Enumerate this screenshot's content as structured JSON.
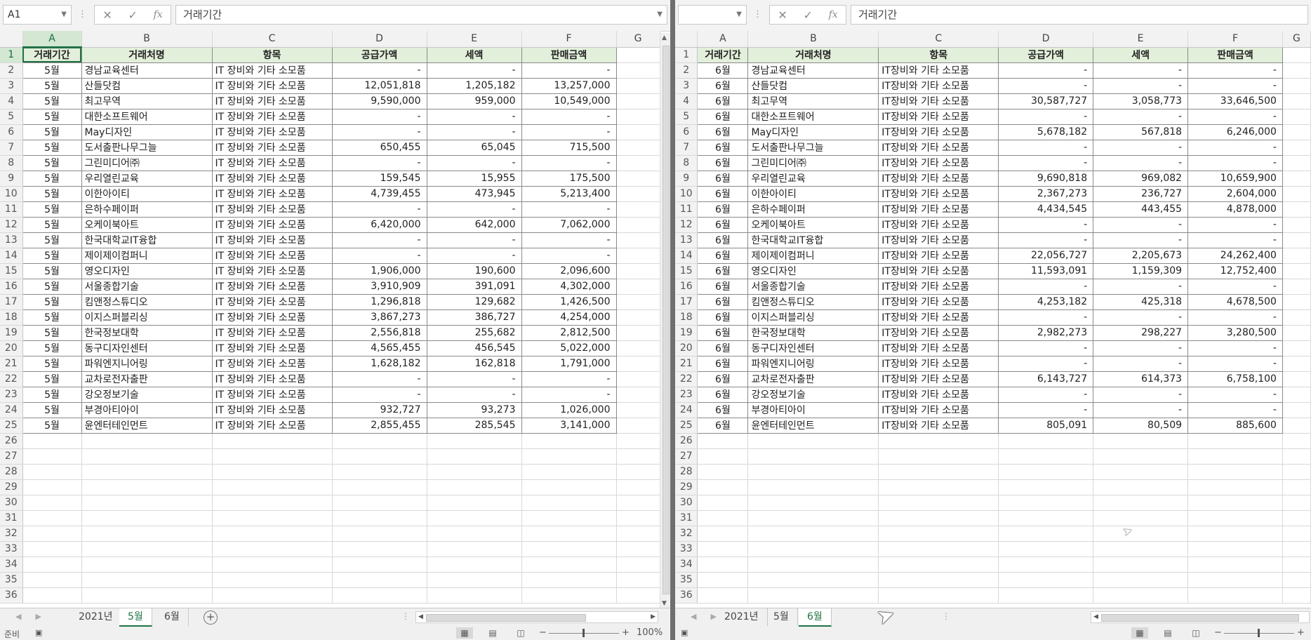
{
  "left": {
    "namebox": "A1",
    "formula": "거래기간",
    "columns": [
      "A",
      "B",
      "C",
      "D",
      "E",
      "F",
      "G"
    ],
    "header": [
      "거래기간",
      "거래처명",
      "항목",
      "공급가액",
      "세액",
      "판매금액"
    ],
    "rows": [
      [
        "5월",
        "경남교육센터",
        "IT 장비와 기타 소모품",
        "-",
        "-",
        "-"
      ],
      [
        "5월",
        "산들닷컴",
        "IT 장비와 기타 소모품",
        "12,051,818",
        "1,205,182",
        "13,257,000"
      ],
      [
        "5월",
        "최고무역",
        "IT 장비와 기타 소모품",
        "9,590,000",
        "959,000",
        "10,549,000"
      ],
      [
        "5월",
        "대한소프트웨어",
        "IT 장비와 기타 소모품",
        "-",
        "-",
        "-"
      ],
      [
        "5월",
        "May디자인",
        "IT 장비와 기타 소모품",
        "-",
        "-",
        "-"
      ],
      [
        "5월",
        "도서출판나무그늘",
        "IT 장비와 기타 소모품",
        "650,455",
        "65,045",
        "715,500"
      ],
      [
        "5월",
        "그린미디어㈜",
        "IT 장비와 기타 소모품",
        "-",
        "-",
        "-"
      ],
      [
        "5월",
        "우리열린교육",
        "IT 장비와 기타 소모품",
        "159,545",
        "15,955",
        "175,500"
      ],
      [
        "5월",
        "이한아이티",
        "IT 장비와 기타 소모품",
        "4,739,455",
        "473,945",
        "5,213,400"
      ],
      [
        "5월",
        "은하수페이퍼",
        "IT 장비와 기타 소모품",
        "-",
        "-",
        "-"
      ],
      [
        "5월",
        "오케이북아트",
        "IT 장비와 기타 소모품",
        "6,420,000",
        "642,000",
        "7,062,000"
      ],
      [
        "5월",
        "한국대학교IT융합",
        "IT 장비와 기타 소모품",
        "-",
        "-",
        "-"
      ],
      [
        "5월",
        "제이제이컴퍼니",
        "IT 장비와 기타 소모품",
        "-",
        "-",
        "-"
      ],
      [
        "5월",
        "영오디자인",
        "IT 장비와 기타 소모품",
        "1,906,000",
        "190,600",
        "2,096,600"
      ],
      [
        "5월",
        "서울종합기술",
        "IT 장비와 기타 소모품",
        "3,910,909",
        "391,091",
        "4,302,000"
      ],
      [
        "5월",
        "킴앤정스튜디오",
        "IT 장비와 기타 소모품",
        "1,296,818",
        "129,682",
        "1,426,500"
      ],
      [
        "5월",
        "이지스퍼블리싱",
        "IT 장비와 기타 소모품",
        "3,867,273",
        "386,727",
        "4,254,000"
      ],
      [
        "5월",
        "한국정보대학",
        "IT 장비와 기타 소모품",
        "2,556,818",
        "255,682",
        "2,812,500"
      ],
      [
        "5월",
        "동구디자인센터",
        "IT 장비와 기타 소모품",
        "4,565,455",
        "456,545",
        "5,022,000"
      ],
      [
        "5월",
        "파워엔지니어링",
        "IT 장비와 기타 소모품",
        "1,628,182",
        "162,818",
        "1,791,000"
      ],
      [
        "5월",
        "교차로전자출판",
        "IT 장비와 기타 소모품",
        "-",
        "-",
        "-"
      ],
      [
        "5월",
        "강오정보기술",
        "IT 장비와 기타 소모품",
        "-",
        "-",
        "-"
      ],
      [
        "5월",
        "부경아티아이",
        "IT 장비와 기타 소모품",
        "932,727",
        "93,273",
        "1,026,000"
      ],
      [
        "5월",
        "윤엔터테인먼트",
        "IT 장비와 기타 소모품",
        "2,855,455",
        "285,545",
        "3,141,000"
      ]
    ],
    "tabs": [
      "2021년",
      "5월",
      "6월"
    ],
    "active_tab": "5월"
  },
  "right": {
    "namebox": "",
    "formula": "거래기간",
    "columns": [
      "A",
      "B",
      "C",
      "D",
      "E",
      "F",
      "G"
    ],
    "header": [
      "거래기간",
      "거래처명",
      "항목",
      "공급가액",
      "세액",
      "판매금액"
    ],
    "rows": [
      [
        "6월",
        "경남교육센터",
        "IT장비와 기타 소모품",
        "-",
        "-",
        "-"
      ],
      [
        "6월",
        "산들닷컴",
        "IT장비와 기타 소모품",
        "-",
        "-",
        "-"
      ],
      [
        "6월",
        "최고무역",
        "IT장비와 기타 소모품",
        "30,587,727",
        "3,058,773",
        "33,646,500"
      ],
      [
        "6월",
        "대한소프트웨어",
        "IT장비와 기타 소모품",
        "-",
        "-",
        "-"
      ],
      [
        "6월",
        "May디자인",
        "IT장비와 기타 소모품",
        "5,678,182",
        "567,818",
        "6,246,000"
      ],
      [
        "6월",
        "도서출판나무그늘",
        "IT장비와 기타 소모품",
        "-",
        "-",
        "-"
      ],
      [
        "6월",
        "그린미디어㈜",
        "IT장비와 기타 소모품",
        "-",
        "-",
        "-"
      ],
      [
        "6월",
        "우리열린교육",
        "IT장비와 기타 소모품",
        "9,690,818",
        "969,082",
        "10,659,900"
      ],
      [
        "6월",
        "이한아이티",
        "IT장비와 기타 소모품",
        "2,367,273",
        "236,727",
        "2,604,000"
      ],
      [
        "6월",
        "은하수페이퍼",
        "IT장비와 기타 소모품",
        "4,434,545",
        "443,455",
        "4,878,000"
      ],
      [
        "6월",
        "오케이북아트",
        "IT장비와 기타 소모품",
        "-",
        "-",
        "-"
      ],
      [
        "6월",
        "한국대학교IT융합",
        "IT장비와 기타 소모품",
        "-",
        "-",
        "-"
      ],
      [
        "6월",
        "제이제이컴퍼니",
        "IT장비와 기타 소모품",
        "22,056,727",
        "2,205,673",
        "24,262,400"
      ],
      [
        "6월",
        "영오디자인",
        "IT장비와 기타 소모품",
        "11,593,091",
        "1,159,309",
        "12,752,400"
      ],
      [
        "6월",
        "서울종합기술",
        "IT장비와 기타 소모품",
        "-",
        "-",
        "-"
      ],
      [
        "6월",
        "킴앤정스튜디오",
        "IT장비와 기타 소모품",
        "4,253,182",
        "425,318",
        "4,678,500"
      ],
      [
        "6월",
        "이지스퍼블리싱",
        "IT장비와 기타 소모품",
        "-",
        "-",
        "-"
      ],
      [
        "6월",
        "한국정보대학",
        "IT장비와 기타 소모품",
        "2,982,273",
        "298,227",
        "3,280,500"
      ],
      [
        "6월",
        "동구디자인센터",
        "IT장비와 기타 소모품",
        "-",
        "-",
        "-"
      ],
      [
        "6월",
        "파워엔지니어링",
        "IT장비와 기타 소모품",
        "-",
        "-",
        "-"
      ],
      [
        "6월",
        "교차로전자출판",
        "IT장비와 기타 소모품",
        "6,143,727",
        "614,373",
        "6,758,100"
      ],
      [
        "6월",
        "강오정보기술",
        "IT장비와 기타 소모품",
        "-",
        "-",
        "-"
      ],
      [
        "6월",
        "부경아티아이",
        "IT장비와 기타 소모품",
        "-",
        "-",
        "-"
      ],
      [
        "6월",
        "윤엔터테인먼트",
        "IT장비와 기타 소모품",
        "805,091",
        "80,509",
        "885,600"
      ]
    ],
    "tabs": [
      "2021년",
      "5월",
      "6월"
    ],
    "active_tab": "6월"
  },
  "row_numbers": [
    "1",
    "2",
    "3",
    "4",
    "5",
    "6",
    "7",
    "8",
    "9",
    "10",
    "11",
    "12",
    "13",
    "14",
    "15",
    "16",
    "17",
    "18",
    "19",
    "20",
    "21",
    "22",
    "23",
    "24",
    "25",
    "26",
    "27",
    "28",
    "29",
    "30",
    "31",
    "32",
    "33",
    "34",
    "35",
    "36"
  ],
  "status": {
    "ready": "준비",
    "zoom": "100%"
  },
  "icons": {
    "cancel": "close-icon",
    "enter": "check-icon",
    "function": "fx-icon",
    "new_sheet": "plus-icon"
  },
  "colors": {
    "accent": "#217346",
    "header_fill": "#e2efda"
  }
}
